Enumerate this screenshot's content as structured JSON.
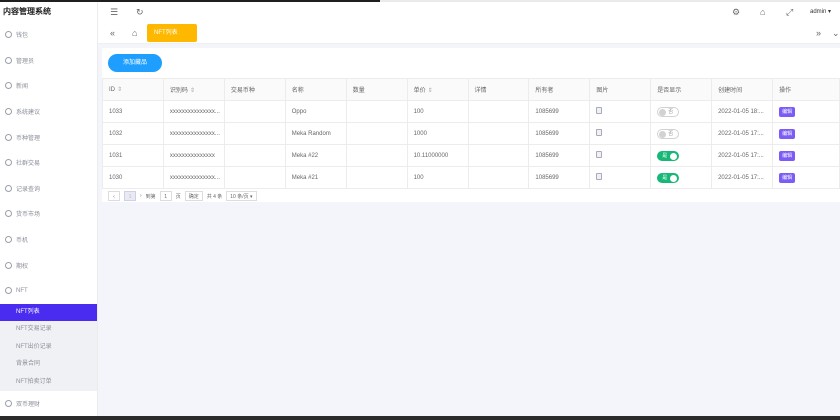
{
  "app": {
    "title": "内容管理系统"
  },
  "header": {
    "user": "admin",
    "user_caret": "▾"
  },
  "sidebar": {
    "items": [
      {
        "label": "钱包",
        "icon": "wallet-icon"
      },
      {
        "label": "管理员",
        "icon": "user-icon"
      },
      {
        "label": "新闻",
        "icon": "news-icon"
      },
      {
        "label": "系统建议",
        "icon": "advice-icon"
      },
      {
        "label": "币种管理",
        "icon": "coin-icon"
      },
      {
        "label": "社群交易",
        "icon": "community-icon"
      },
      {
        "label": "记录查询",
        "icon": "record-icon"
      },
      {
        "label": "货币市场",
        "icon": "market-icon"
      },
      {
        "label": "币机",
        "icon": "machine-icon"
      },
      {
        "label": "期权",
        "icon": "option-icon"
      },
      {
        "label": "NFT",
        "icon": "nft-icon"
      }
    ],
    "nft_sub": [
      {
        "label": "NFT列表",
        "active": true
      },
      {
        "label": "NFT交易记录",
        "active": false
      },
      {
        "label": "NFT出价记录",
        "active": false
      },
      {
        "label": "背景合同",
        "active": false
      },
      {
        "label": "NFT拍卖订单",
        "active": false
      }
    ],
    "last_item": {
      "label": "双币理财",
      "icon": "finance-icon"
    }
  },
  "tabs": {
    "active_label": "NFT列表"
  },
  "toolbar": {
    "add_label": "添加藏品"
  },
  "table": {
    "headers": [
      "ID",
      "识别码",
      "交易币种",
      "名称",
      "数量",
      "单价",
      "详情",
      "所有者",
      "图片",
      "是否显示",
      "创建时间",
      "操作"
    ],
    "rows": [
      {
        "id": "1033",
        "code": "xxxxxxxxxxxxxxx...",
        "currency": "",
        "name": "Oppo",
        "qty": "",
        "price": "100",
        "detail": "",
        "owner": "1085699",
        "show": false,
        "show_text": "否",
        "created": "2022-01-05 18:...",
        "action": "编辑"
      },
      {
        "id": "1032",
        "code": "xxxxxxxxxxxxxxx...",
        "currency": "",
        "name": "Meka Random",
        "qty": "",
        "price": "1000",
        "detail": "",
        "owner": "1085699",
        "show": false,
        "show_text": "否",
        "created": "2022-01-05 17:...",
        "action": "编辑"
      },
      {
        "id": "1031",
        "code": "xxxxxxxxxxxxxxx",
        "currency": "",
        "name": "Meka #22",
        "qty": "",
        "price": "10.11000000",
        "detail": "",
        "owner": "1085699",
        "show": true,
        "show_text": "是",
        "created": "2022-01-05 17:...",
        "action": "编辑"
      },
      {
        "id": "1030",
        "code": "xxxxxxxxxxxxxxx...",
        "currency": "",
        "name": "Meka #21",
        "qty": "",
        "price": "100",
        "detail": "",
        "owner": "1085699",
        "show": true,
        "show_text": "是",
        "created": "2022-01-05 17:...",
        "action": "编辑"
      }
    ]
  },
  "pager": {
    "prev": "‹",
    "current": "1",
    "next": "›",
    "goto_label": "到第",
    "page_value": "1",
    "page_unit": "页",
    "confirm": "确定",
    "total": "共 4 条",
    "per_page": "10 条/页"
  }
}
